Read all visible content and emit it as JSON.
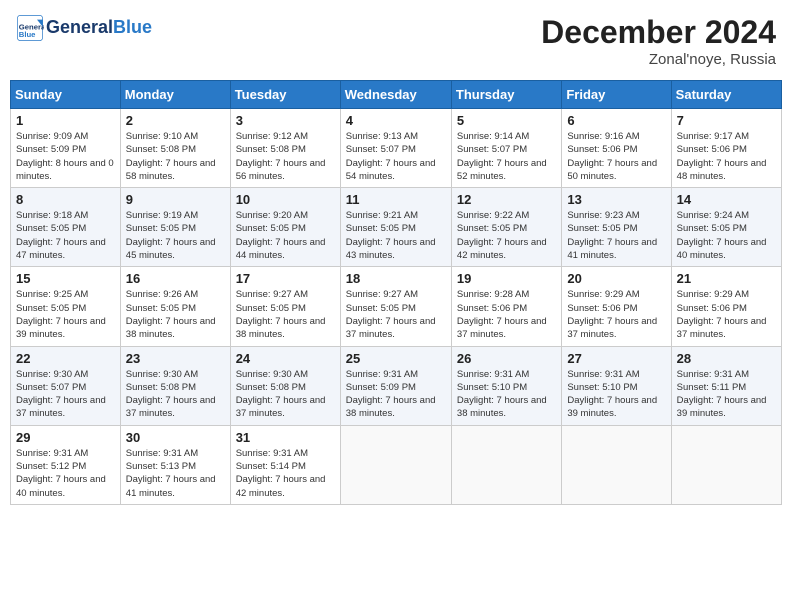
{
  "header": {
    "logo_line1": "General",
    "logo_line2": "Blue",
    "month_title": "December 2024",
    "location": "Zonal'noye, Russia"
  },
  "weekdays": [
    "Sunday",
    "Monday",
    "Tuesday",
    "Wednesday",
    "Thursday",
    "Friday",
    "Saturday"
  ],
  "weeks": [
    [
      {
        "day": "1",
        "sunrise": "Sunrise: 9:09 AM",
        "sunset": "Sunset: 5:09 PM",
        "daylight": "Daylight: 8 hours and 0 minutes."
      },
      {
        "day": "2",
        "sunrise": "Sunrise: 9:10 AM",
        "sunset": "Sunset: 5:08 PM",
        "daylight": "Daylight: 7 hours and 58 minutes."
      },
      {
        "day": "3",
        "sunrise": "Sunrise: 9:12 AM",
        "sunset": "Sunset: 5:08 PM",
        "daylight": "Daylight: 7 hours and 56 minutes."
      },
      {
        "day": "4",
        "sunrise": "Sunrise: 9:13 AM",
        "sunset": "Sunset: 5:07 PM",
        "daylight": "Daylight: 7 hours and 54 minutes."
      },
      {
        "day": "5",
        "sunrise": "Sunrise: 9:14 AM",
        "sunset": "Sunset: 5:07 PM",
        "daylight": "Daylight: 7 hours and 52 minutes."
      },
      {
        "day": "6",
        "sunrise": "Sunrise: 9:16 AM",
        "sunset": "Sunset: 5:06 PM",
        "daylight": "Daylight: 7 hours and 50 minutes."
      },
      {
        "day": "7",
        "sunrise": "Sunrise: 9:17 AM",
        "sunset": "Sunset: 5:06 PM",
        "daylight": "Daylight: 7 hours and 48 minutes."
      }
    ],
    [
      {
        "day": "8",
        "sunrise": "Sunrise: 9:18 AM",
        "sunset": "Sunset: 5:05 PM",
        "daylight": "Daylight: 7 hours and 47 minutes."
      },
      {
        "day": "9",
        "sunrise": "Sunrise: 9:19 AM",
        "sunset": "Sunset: 5:05 PM",
        "daylight": "Daylight: 7 hours and 45 minutes."
      },
      {
        "day": "10",
        "sunrise": "Sunrise: 9:20 AM",
        "sunset": "Sunset: 5:05 PM",
        "daylight": "Daylight: 7 hours and 44 minutes."
      },
      {
        "day": "11",
        "sunrise": "Sunrise: 9:21 AM",
        "sunset": "Sunset: 5:05 PM",
        "daylight": "Daylight: 7 hours and 43 minutes."
      },
      {
        "day": "12",
        "sunrise": "Sunrise: 9:22 AM",
        "sunset": "Sunset: 5:05 PM",
        "daylight": "Daylight: 7 hours and 42 minutes."
      },
      {
        "day": "13",
        "sunrise": "Sunrise: 9:23 AM",
        "sunset": "Sunset: 5:05 PM",
        "daylight": "Daylight: 7 hours and 41 minutes."
      },
      {
        "day": "14",
        "sunrise": "Sunrise: 9:24 AM",
        "sunset": "Sunset: 5:05 PM",
        "daylight": "Daylight: 7 hours and 40 minutes."
      }
    ],
    [
      {
        "day": "15",
        "sunrise": "Sunrise: 9:25 AM",
        "sunset": "Sunset: 5:05 PM",
        "daylight": "Daylight: 7 hours and 39 minutes."
      },
      {
        "day": "16",
        "sunrise": "Sunrise: 9:26 AM",
        "sunset": "Sunset: 5:05 PM",
        "daylight": "Daylight: 7 hours and 38 minutes."
      },
      {
        "day": "17",
        "sunrise": "Sunrise: 9:27 AM",
        "sunset": "Sunset: 5:05 PM",
        "daylight": "Daylight: 7 hours and 38 minutes."
      },
      {
        "day": "18",
        "sunrise": "Sunrise: 9:27 AM",
        "sunset": "Sunset: 5:05 PM",
        "daylight": "Daylight: 7 hours and 37 minutes."
      },
      {
        "day": "19",
        "sunrise": "Sunrise: 9:28 AM",
        "sunset": "Sunset: 5:06 PM",
        "daylight": "Daylight: 7 hours and 37 minutes."
      },
      {
        "day": "20",
        "sunrise": "Sunrise: 9:29 AM",
        "sunset": "Sunset: 5:06 PM",
        "daylight": "Daylight: 7 hours and 37 minutes."
      },
      {
        "day": "21",
        "sunrise": "Sunrise: 9:29 AM",
        "sunset": "Sunset: 5:06 PM",
        "daylight": "Daylight: 7 hours and 37 minutes."
      }
    ],
    [
      {
        "day": "22",
        "sunrise": "Sunrise: 9:30 AM",
        "sunset": "Sunset: 5:07 PM",
        "daylight": "Daylight: 7 hours and 37 minutes."
      },
      {
        "day": "23",
        "sunrise": "Sunrise: 9:30 AM",
        "sunset": "Sunset: 5:08 PM",
        "daylight": "Daylight: 7 hours and 37 minutes."
      },
      {
        "day": "24",
        "sunrise": "Sunrise: 9:30 AM",
        "sunset": "Sunset: 5:08 PM",
        "daylight": "Daylight: 7 hours and 37 minutes."
      },
      {
        "day": "25",
        "sunrise": "Sunrise: 9:31 AM",
        "sunset": "Sunset: 5:09 PM",
        "daylight": "Daylight: 7 hours and 38 minutes."
      },
      {
        "day": "26",
        "sunrise": "Sunrise: 9:31 AM",
        "sunset": "Sunset: 5:10 PM",
        "daylight": "Daylight: 7 hours and 38 minutes."
      },
      {
        "day": "27",
        "sunrise": "Sunrise: 9:31 AM",
        "sunset": "Sunset: 5:10 PM",
        "daylight": "Daylight: 7 hours and 39 minutes."
      },
      {
        "day": "28",
        "sunrise": "Sunrise: 9:31 AM",
        "sunset": "Sunset: 5:11 PM",
        "daylight": "Daylight: 7 hours and 39 minutes."
      }
    ],
    [
      {
        "day": "29",
        "sunrise": "Sunrise: 9:31 AM",
        "sunset": "Sunset: 5:12 PM",
        "daylight": "Daylight: 7 hours and 40 minutes."
      },
      {
        "day": "30",
        "sunrise": "Sunrise: 9:31 AM",
        "sunset": "Sunset: 5:13 PM",
        "daylight": "Daylight: 7 hours and 41 minutes."
      },
      {
        "day": "31",
        "sunrise": "Sunrise: 9:31 AM",
        "sunset": "Sunset: 5:14 PM",
        "daylight": "Daylight: 7 hours and 42 minutes."
      },
      null,
      null,
      null,
      null
    ]
  ]
}
